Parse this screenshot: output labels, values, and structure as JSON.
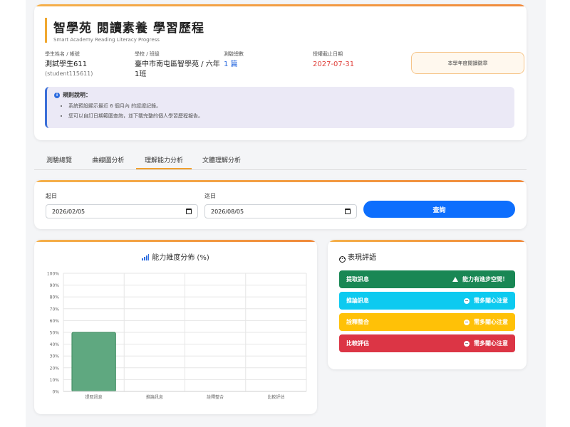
{
  "header": {
    "title": "智學苑 閱讀素養 學習歷程",
    "subtitle": "Smart Academy Reading Literacy Progress",
    "student_label": "學生姓名 / 帳號",
    "student_name": "測試學生611",
    "student_account": "(student115611)",
    "school_label": "學校 / 班級",
    "school_value": "臺中市南屯區智學苑 / 六年",
    "class_value": "1班",
    "tests_label": "測驗總數",
    "tests_value": "1 篇",
    "expiry_label": "授權截止日期",
    "expiry_value": "2027-07-31",
    "badge": "本學年度閱讀徽章",
    "rules_title": "規則說明：",
    "rules": [
      "系統預設顯示最近 6 個月內 的認證記錄。",
      "您可以自訂日期範圍查詢，並下載完整的個人學習歷程報告。"
    ]
  },
  "tabs": [
    "測驗總覽",
    "曲線圖分析",
    "理解能力分析",
    "文體理解分析"
  ],
  "active_tab": "理解能力分析",
  "filter": {
    "start_label": "起日",
    "start_value": "2026/02/05",
    "end_label": "迄日",
    "end_value": "2026/08/05",
    "query_button": "查詢"
  },
  "chart_icon": "bar-chart-icon",
  "chart_data": {
    "type": "bar",
    "title": "能力維度分佈 (%)",
    "categories": [
      "提取訊息",
      "推論訊息",
      "詮釋整合",
      "比較評估"
    ],
    "values": [
      50,
      0,
      0,
      0
    ],
    "ylim": [
      0,
      100
    ],
    "yticks": [
      "0%",
      "10%",
      "20%",
      "30%",
      "40%",
      "50%",
      "60%",
      "70%",
      "80%",
      "90%",
      "100%"
    ],
    "bar_color": "#5fa880",
    "bar_border": "#3d8a5e",
    "grid": true
  },
  "comments": {
    "title": "表現評語",
    "items": [
      {
        "label": "提取訊息",
        "status": "能力有進步空間！",
        "color": "#198754",
        "icon": "warning-icon"
      },
      {
        "label": "推論訊息",
        "status": "需多關心注意",
        "color": "#0dcaf0",
        "icon": "minus-circle-icon"
      },
      {
        "label": "詮釋整合",
        "status": "需多關心注意",
        "color": "#ffc107",
        "icon": "minus-circle-icon"
      },
      {
        "label": "比較評估",
        "status": "需多關心注意",
        "color": "#dc3545",
        "icon": "minus-circle-icon"
      }
    ]
  }
}
